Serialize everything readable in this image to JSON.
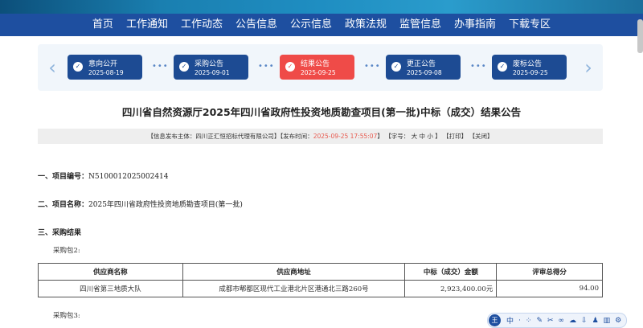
{
  "nav": {
    "items": [
      "首页",
      "工作通知",
      "工作动态",
      "公告信息",
      "公示信息",
      "政策法规",
      "监管信息",
      "办事指南",
      "下载专区"
    ]
  },
  "steps": [
    {
      "label": "意向公开",
      "date": "2025-08-19"
    },
    {
      "label": "采购公告",
      "date": "2025-09-01"
    },
    {
      "label": "结果公告",
      "date": "2025-09-25"
    },
    {
      "label": "更正公告",
      "date": "2025-09-08"
    },
    {
      "label": "废标公告",
      "date": "2025-09-25"
    }
  ],
  "title": "四川省自然资源厅2025年四川省政府性投资地质勘查项目(第一批)中标（成交）结果公告",
  "meta": {
    "publisher": "【信息发布主体：四川正汇恒招标代理有限公司】",
    "time_prefix": "【发布时间：",
    "time": "2025-09-25 17:55:07",
    "time_suffix": "】",
    "font": "【字号： 大 中 小 】",
    "print": "【打印】",
    "close": "【关闭】"
  },
  "sections": {
    "s1_label": "一、项目编号：",
    "s1_value": "N5100012025002414",
    "s2_label": "二、项目名称：",
    "s2_value": "2025年四川省政府性投资地质勘查项目(第一批)",
    "s3_label": "三、采购结果",
    "pkg2": "采购包2:",
    "pkg3": "采购包3:"
  },
  "table": {
    "headers": [
      "供应商名称",
      "供应商地址",
      "中标（成交）金额",
      "评审总得分"
    ],
    "rows": [
      [
        "四川省第三地质大队",
        "成都市郫都区现代工业港北片区港通北三路260号",
        "2,923,400.00元",
        "94.00"
      ]
    ]
  },
  "toolbar": {
    "logo": "王",
    "items": [
      "中",
      "·",
      "⁘",
      "✎",
      "✂",
      "∞",
      "☁",
      "⇩",
      "♟",
      "▥",
      "⚙"
    ]
  },
  "colors": {
    "nav_bg": "#1e4fa0",
    "step_bg": "#1d4b93",
    "step_active": "#ef4b48",
    "highlight": "#e85a4f"
  }
}
